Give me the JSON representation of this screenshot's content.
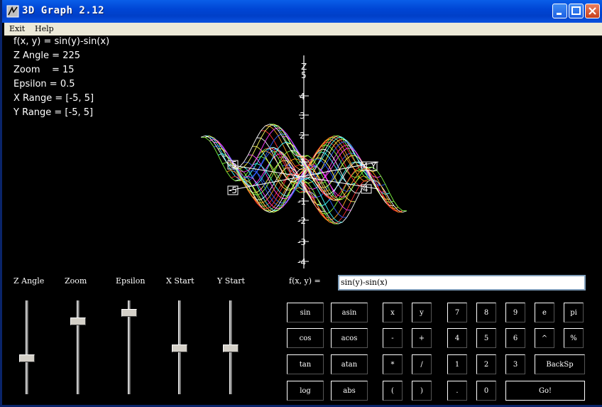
{
  "window": {
    "title": "3D Graph 2.12"
  },
  "menu": [
    "Exit",
    "Help"
  ],
  "info": {
    "function": "f(x, y) = sin(y)-sin(x)",
    "z_angle": "Z Angle = 225",
    "zoom": "Zoom    = 15",
    "epsilon": "Epsilon = 0.5",
    "x_range": "X Range = [-5, 5]",
    "y_range": "Y Range = [-5, 5]"
  },
  "axis_labels": {
    "z_tick_top": "5",
    "z_name": "Z",
    "z4": "4",
    "z3": "3",
    "z2": "2",
    "z1": "1",
    "zm1": "-1",
    "zm2": "-2",
    "zm3": "-3",
    "zm4": "-4",
    "x_neg": "-5",
    "x_pos": "4",
    "y_pos": "4 Y",
    "y_neg": "-5"
  },
  "sliders": [
    {
      "label": "Z Angle",
      "value": 0.62
    },
    {
      "label": "Zoom",
      "value": 0.18
    },
    {
      "label": "Epsilon",
      "value": 0.08
    },
    {
      "label": "X Start",
      "value": 0.5
    },
    {
      "label": "Y Start",
      "value": 0.5
    }
  ],
  "expression": {
    "label": "f(x, y) =",
    "value": "sin(y)-sin(x)"
  },
  "keypad": {
    "sin": "sin",
    "asin": "asin",
    "cos": "cos",
    "acos": "acos",
    "tan": "tan",
    "atan": "atan",
    "log": "log",
    "abs": "abs",
    "x": "x",
    "y": "y",
    "minus": "-",
    "plus": "+",
    "times": "*",
    "divide": "/",
    "lparen": "(",
    "rparen": ")",
    "d7": "7",
    "d8": "8",
    "d9": "9",
    "e": "e",
    "pi": "pi",
    "d4": "4",
    "d5": "5",
    "d6": "6",
    "caret": "^",
    "percent": "%",
    "d1": "1",
    "d2": "2",
    "d3": "3",
    "backsp": "BackSp",
    "dot": ".",
    "d0": "0",
    "go": "Go!"
  },
  "colors": {
    "title_bar": "#0046d5",
    "background": "#000000",
    "mesh_palette": [
      "#ffffff",
      "#ff3030",
      "#ffa020",
      "#80ff40",
      "#40ffff",
      "#3060ff",
      "#ff40ff",
      "#ffff60"
    ]
  },
  "icons": [
    "app-icon",
    "minimize-icon",
    "maximize-icon",
    "close-icon"
  ]
}
